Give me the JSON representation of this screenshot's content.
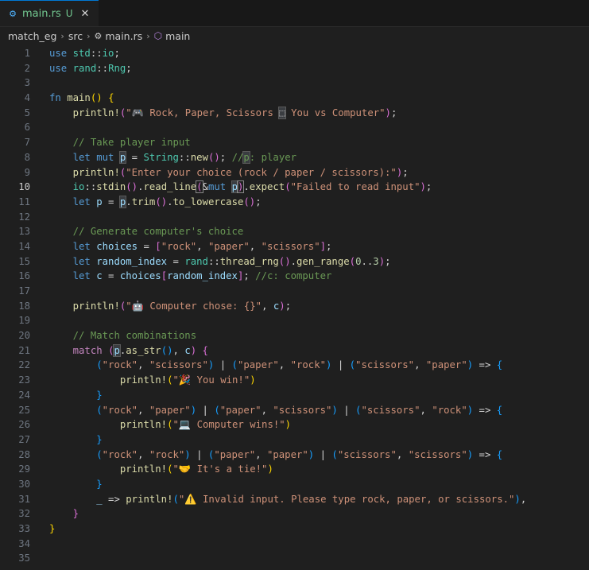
{
  "tab": {
    "icon": "rust-gear-icon",
    "name": "main.rs",
    "status": "U",
    "close": "✕"
  },
  "breadcrumb": {
    "folder": "match_eg",
    "src": "src",
    "file": "main.rs",
    "symbol": "main"
  },
  "editor": {
    "active_line": 10,
    "lines": [
      {
        "n": "1"
      },
      {
        "n": "2"
      },
      {
        "n": "3"
      },
      {
        "n": "4"
      },
      {
        "n": "5"
      },
      {
        "n": "6"
      },
      {
        "n": "7"
      },
      {
        "n": "8"
      },
      {
        "n": "9"
      },
      {
        "n": "10"
      },
      {
        "n": "11"
      },
      {
        "n": "12"
      },
      {
        "n": "13"
      },
      {
        "n": "14"
      },
      {
        "n": "15"
      },
      {
        "n": "16"
      },
      {
        "n": "17"
      },
      {
        "n": "18"
      },
      {
        "n": "19"
      },
      {
        "n": "20"
      },
      {
        "n": "21"
      },
      {
        "n": "22"
      },
      {
        "n": "23"
      },
      {
        "n": "24"
      },
      {
        "n": "25"
      },
      {
        "n": "26"
      },
      {
        "n": "27"
      },
      {
        "n": "28"
      },
      {
        "n": "29"
      },
      {
        "n": "30"
      },
      {
        "n": "31"
      },
      {
        "n": "32"
      },
      {
        "n": "33"
      },
      {
        "n": "34"
      },
      {
        "n": "35"
      }
    ],
    "code": [
      [
        [
          "kw",
          "use"
        ],
        [
          "punc",
          " "
        ],
        [
          "ty",
          "std"
        ],
        [
          "punc",
          "::"
        ],
        [
          "ty",
          "io"
        ],
        [
          "punc",
          ";"
        ]
      ],
      [
        [
          "kw",
          "use"
        ],
        [
          "punc",
          " "
        ],
        [
          "ty",
          "rand"
        ],
        [
          "punc",
          "::"
        ],
        [
          "ty",
          "Rng"
        ],
        [
          "punc",
          ";"
        ]
      ],
      [],
      [
        [
          "kw",
          "fn"
        ],
        [
          "punc",
          " "
        ],
        [
          "fn",
          "main"
        ],
        [
          "p1",
          "()"
        ],
        [
          "punc",
          " "
        ],
        [
          "p1",
          "{"
        ]
      ],
      [
        [
          "punc",
          "    "
        ],
        [
          "fn",
          "println!"
        ],
        [
          "p2",
          "("
        ],
        [
          "str",
          "\"🎮 Rock, Paper, Scissors "
        ],
        [
          "hl",
          "⬚"
        ],
        [
          "str",
          " You vs Computer\""
        ],
        [
          "p2",
          ")"
        ],
        [
          "punc",
          ";"
        ]
      ],
      [],
      [
        [
          "punc",
          "    "
        ],
        [
          "com",
          "// Take player input"
        ]
      ],
      [
        [
          "punc",
          "    "
        ],
        [
          "kw",
          "let"
        ],
        [
          "punc",
          " "
        ],
        [
          "kw",
          "mut"
        ],
        [
          "punc",
          " "
        ],
        [
          "var hl",
          "p"
        ],
        [
          "punc",
          " = "
        ],
        [
          "ty",
          "String"
        ],
        [
          "punc",
          "::"
        ],
        [
          "fn",
          "new"
        ],
        [
          "p2",
          "()"
        ],
        [
          "punc",
          "; "
        ],
        [
          "com",
          "//"
        ],
        [
          "com hl",
          "p"
        ],
        [
          "com",
          ": player"
        ]
      ],
      [
        [
          "punc",
          "    "
        ],
        [
          "fn",
          "println!"
        ],
        [
          "p2",
          "("
        ],
        [
          "str",
          "\"Enter your choice (rock / paper / scissors):\""
        ],
        [
          "p2",
          ")"
        ],
        [
          "punc",
          ";"
        ]
      ],
      [
        [
          "punc",
          "    "
        ],
        [
          "ty",
          "io"
        ],
        [
          "punc",
          "::"
        ],
        [
          "fn",
          "stdin"
        ],
        [
          "p2",
          "()"
        ],
        [
          "punc",
          "."
        ],
        [
          "fn",
          "read_line"
        ],
        [
          "p2 brk",
          "("
        ],
        [
          "punc",
          "&"
        ],
        [
          "kw",
          "mut"
        ],
        [
          "punc",
          " "
        ],
        [
          "var hl",
          "p"
        ],
        [
          "p2 brk",
          ")"
        ],
        [
          "punc",
          "."
        ],
        [
          "fn",
          "expect"
        ],
        [
          "p2",
          "("
        ],
        [
          "str",
          "\"Failed to read input\""
        ],
        [
          "p2",
          ")"
        ],
        [
          "punc",
          ";"
        ]
      ],
      [
        [
          "punc",
          "    "
        ],
        [
          "kw",
          "let"
        ],
        [
          "punc",
          " "
        ],
        [
          "var",
          "p"
        ],
        [
          "punc",
          " = "
        ],
        [
          "var hl",
          "p"
        ],
        [
          "punc",
          "."
        ],
        [
          "fn",
          "trim"
        ],
        [
          "p2",
          "()"
        ],
        [
          "punc",
          "."
        ],
        [
          "fn",
          "to_lowercase"
        ],
        [
          "p2",
          "()"
        ],
        [
          "punc",
          ";"
        ]
      ],
      [],
      [
        [
          "punc",
          "    "
        ],
        [
          "com",
          "// Generate computer's choice"
        ]
      ],
      [
        [
          "punc",
          "    "
        ],
        [
          "kw",
          "let"
        ],
        [
          "punc",
          " "
        ],
        [
          "var",
          "choices"
        ],
        [
          "punc",
          " = "
        ],
        [
          "p2",
          "["
        ],
        [
          "str",
          "\"rock\""
        ],
        [
          "punc",
          ", "
        ],
        [
          "str",
          "\"paper\""
        ],
        [
          "punc",
          ", "
        ],
        [
          "str",
          "\"scissors\""
        ],
        [
          "p2",
          "]"
        ],
        [
          "punc",
          ";"
        ]
      ],
      [
        [
          "punc",
          "    "
        ],
        [
          "kw",
          "let"
        ],
        [
          "punc",
          " "
        ],
        [
          "var",
          "random_index"
        ],
        [
          "punc",
          " = "
        ],
        [
          "ty",
          "rand"
        ],
        [
          "punc",
          "::"
        ],
        [
          "fn",
          "thread_rng"
        ],
        [
          "p2",
          "()"
        ],
        [
          "punc",
          "."
        ],
        [
          "fn",
          "gen_range"
        ],
        [
          "p2",
          "("
        ],
        [
          "num",
          "0"
        ],
        [
          "punc",
          ".."
        ],
        [
          "num",
          "3"
        ],
        [
          "p2",
          ")"
        ],
        [
          "punc",
          ";"
        ]
      ],
      [
        [
          "punc",
          "    "
        ],
        [
          "kw",
          "let"
        ],
        [
          "punc",
          " "
        ],
        [
          "var",
          "c"
        ],
        [
          "punc",
          " = "
        ],
        [
          "var",
          "choices"
        ],
        [
          "p2",
          "["
        ],
        [
          "var",
          "random_index"
        ],
        [
          "p2",
          "]"
        ],
        [
          "punc",
          "; "
        ],
        [
          "com",
          "//c: computer"
        ]
      ],
      [],
      [
        [
          "punc",
          "    "
        ],
        [
          "fn",
          "println!"
        ],
        [
          "p2",
          "("
        ],
        [
          "str",
          "\"🤖 Computer chose: {}\""
        ],
        [
          "punc",
          ", "
        ],
        [
          "var",
          "c"
        ],
        [
          "p2",
          ")"
        ],
        [
          "punc",
          ";"
        ]
      ],
      [],
      [
        [
          "punc",
          "    "
        ],
        [
          "com",
          "// Match combinations"
        ]
      ],
      [
        [
          "punc",
          "    "
        ],
        [
          "kw2",
          "match"
        ],
        [
          "punc",
          " "
        ],
        [
          "p2",
          "("
        ],
        [
          "var hl",
          "p"
        ],
        [
          "punc",
          "."
        ],
        [
          "fn",
          "as_str"
        ],
        [
          "p3",
          "()"
        ],
        [
          "punc",
          ", "
        ],
        [
          "var",
          "c"
        ],
        [
          "p2",
          ")"
        ],
        [
          "punc",
          " "
        ],
        [
          "p2",
          "{"
        ]
      ],
      [
        [
          "punc",
          "        "
        ],
        [
          "p3",
          "("
        ],
        [
          "str",
          "\"rock\""
        ],
        [
          "punc",
          ", "
        ],
        [
          "str",
          "\"scissors\""
        ],
        [
          "p3",
          ")"
        ],
        [
          "punc",
          " | "
        ],
        [
          "p3",
          "("
        ],
        [
          "str",
          "\"paper\""
        ],
        [
          "punc",
          ", "
        ],
        [
          "str",
          "\"rock\""
        ],
        [
          "p3",
          ")"
        ],
        [
          "punc",
          " | "
        ],
        [
          "p3",
          "("
        ],
        [
          "str",
          "\"scissors\""
        ],
        [
          "punc",
          ", "
        ],
        [
          "str",
          "\"paper\""
        ],
        [
          "p3",
          ")"
        ],
        [
          "punc",
          " => "
        ],
        [
          "p3",
          "{"
        ]
      ],
      [
        [
          "punc",
          "            "
        ],
        [
          "fn",
          "println!"
        ],
        [
          "p1",
          "("
        ],
        [
          "str",
          "\"🎉 You win!\""
        ],
        [
          "p1",
          ")"
        ]
      ],
      [
        [
          "punc",
          "        "
        ],
        [
          "p3",
          "}"
        ]
      ],
      [
        [
          "punc",
          "        "
        ],
        [
          "p3",
          "("
        ],
        [
          "str",
          "\"rock\""
        ],
        [
          "punc",
          ", "
        ],
        [
          "str",
          "\"paper\""
        ],
        [
          "p3",
          ")"
        ],
        [
          "punc",
          " | "
        ],
        [
          "p3",
          "("
        ],
        [
          "str",
          "\"paper\""
        ],
        [
          "punc",
          ", "
        ],
        [
          "str",
          "\"scissors\""
        ],
        [
          "p3",
          ")"
        ],
        [
          "punc",
          " | "
        ],
        [
          "p3",
          "("
        ],
        [
          "str",
          "\"scissors\""
        ],
        [
          "punc",
          ", "
        ],
        [
          "str",
          "\"rock\""
        ],
        [
          "p3",
          ")"
        ],
        [
          "punc",
          " => "
        ],
        [
          "p3",
          "{"
        ]
      ],
      [
        [
          "punc",
          "            "
        ],
        [
          "fn",
          "println!"
        ],
        [
          "p1",
          "("
        ],
        [
          "str",
          "\"💻 Computer wins!\""
        ],
        [
          "p1",
          ")"
        ]
      ],
      [
        [
          "punc",
          "        "
        ],
        [
          "p3",
          "}"
        ]
      ],
      [
        [
          "punc",
          "        "
        ],
        [
          "p3",
          "("
        ],
        [
          "str",
          "\"rock\""
        ],
        [
          "punc",
          ", "
        ],
        [
          "str",
          "\"rock\""
        ],
        [
          "p3",
          ")"
        ],
        [
          "punc",
          " | "
        ],
        [
          "p3",
          "("
        ],
        [
          "str",
          "\"paper\""
        ],
        [
          "punc",
          ", "
        ],
        [
          "str",
          "\"paper\""
        ],
        [
          "p3",
          ")"
        ],
        [
          "punc",
          " | "
        ],
        [
          "p3",
          "("
        ],
        [
          "str",
          "\"scissors\""
        ],
        [
          "punc",
          ", "
        ],
        [
          "str",
          "\"scissors\""
        ],
        [
          "p3",
          ")"
        ],
        [
          "punc",
          " => "
        ],
        [
          "p3",
          "{"
        ]
      ],
      [
        [
          "punc",
          "            "
        ],
        [
          "fn",
          "println!"
        ],
        [
          "p1",
          "("
        ],
        [
          "str",
          "\"🤝 It's a tie!\""
        ],
        [
          "p1",
          ")"
        ]
      ],
      [
        [
          "punc",
          "        "
        ],
        [
          "p3",
          "}"
        ]
      ],
      [
        [
          "punc",
          "        "
        ],
        [
          "var",
          "_"
        ],
        [
          "punc",
          " => "
        ],
        [
          "fn",
          "println!"
        ],
        [
          "p3",
          "("
        ],
        [
          "str",
          "\"⚠️ Invalid input. Please type rock, paper, or scissors.\""
        ],
        [
          "p3",
          ")"
        ],
        [
          "punc",
          ","
        ]
      ],
      [
        [
          "punc",
          "    "
        ],
        [
          "p2",
          "}"
        ]
      ],
      [
        [
          "p1",
          "}"
        ]
      ],
      [],
      []
    ]
  }
}
